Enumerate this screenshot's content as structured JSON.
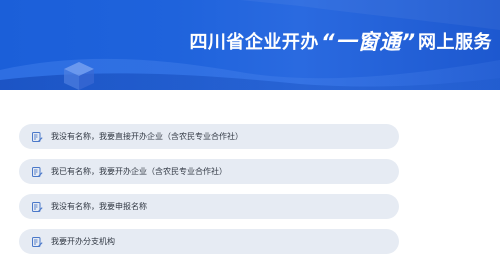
{
  "banner": {
    "title_prefix": "四川省企业开办",
    "title_highlight": "“一窗通”",
    "title_suffix": "网上服务",
    "background_color": "#1f63dc",
    "decoration_icon": "isometric-cube-icon"
  },
  "menu": {
    "item_background": "#e6ebf3",
    "icon_color": "#4a78c9",
    "items": [
      {
        "label": "我没有名称，我要直接开办企业（含农民专业合作社）",
        "icon": "document-edit-icon"
      },
      {
        "label": "我已有名称，我要开办企业（含农民专业合作社）",
        "icon": "document-edit-icon"
      },
      {
        "label": "我没有名称，我要申报名称",
        "icon": "document-edit-icon"
      },
      {
        "label": "我要开办分支机构",
        "icon": "document-edit-icon"
      }
    ]
  }
}
